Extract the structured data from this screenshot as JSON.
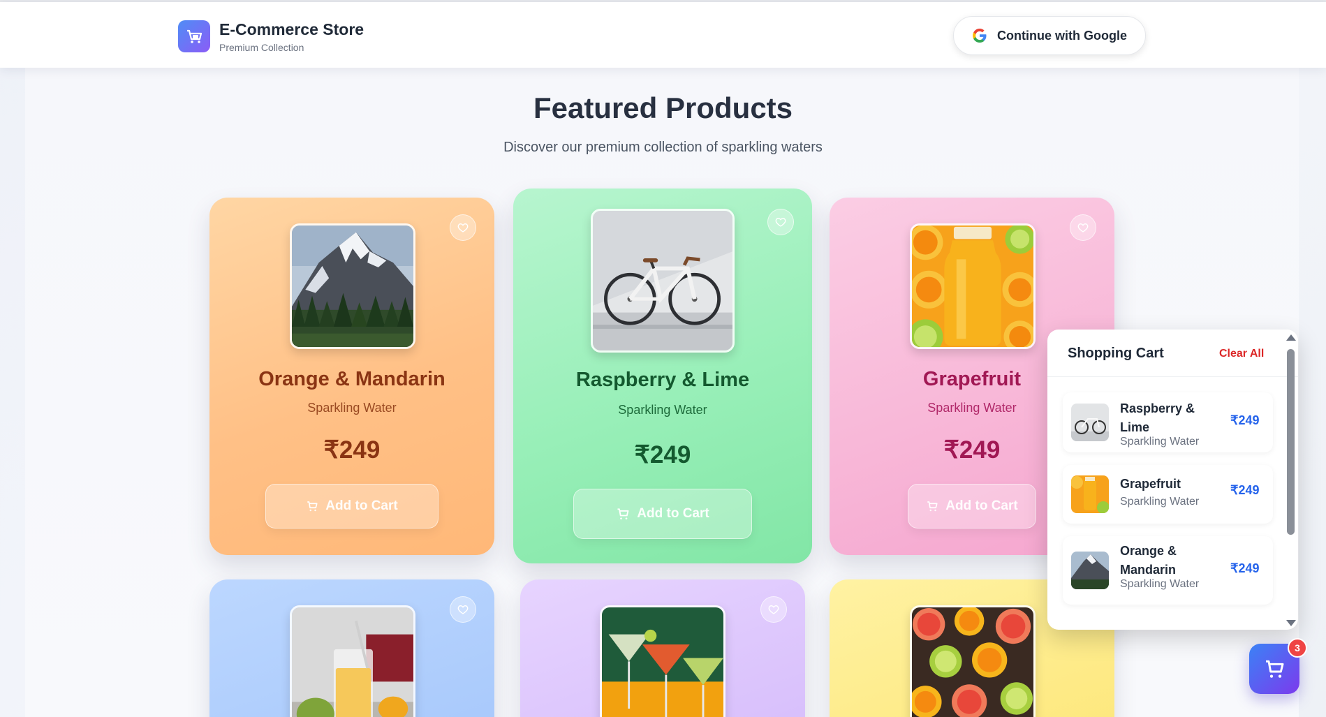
{
  "header": {
    "brand_name": "E-Commerce Store",
    "brand_sub": "Premium Collection",
    "google_label": "Continue with Google"
  },
  "hero": {
    "title": "Featured Products",
    "subtitle": "Discover our premium collection of sparkling waters"
  },
  "products": [
    {
      "name": "Orange & Mandarin",
      "category": "Sparkling Water",
      "price": "₹249",
      "add_label": "Add to Cart",
      "image": "mountain"
    },
    {
      "name": "Raspberry & Lime",
      "category": "Sparkling Water",
      "price": "₹249",
      "add_label": "Add to Cart",
      "image": "bicycle"
    },
    {
      "name": "Grapefruit",
      "category": "Sparkling Water",
      "price": "₹249",
      "add_label": "Add to Cart",
      "image": "orange-juice"
    },
    {
      "image": "mango-smoothie"
    },
    {
      "image": "cocktails"
    },
    {
      "image": "citrus-slices"
    }
  ],
  "cart": {
    "title": "Shopping Cart",
    "clear_label": "Clear All",
    "count": "3",
    "items": [
      {
        "name": "Raspberry & Lime",
        "category": "Sparkling Water",
        "price": "₹249"
      },
      {
        "name": "Grapefruit",
        "category": "Sparkling Water",
        "price": "₹249"
      },
      {
        "name": "Orange & Mandarin",
        "category": "Sparkling Water",
        "price": "₹249"
      }
    ]
  },
  "colors": {
    "accent": "#6366f1",
    "cart_price": "#2563eb",
    "clear_all": "#dc2626",
    "badge": "#ef4444"
  }
}
